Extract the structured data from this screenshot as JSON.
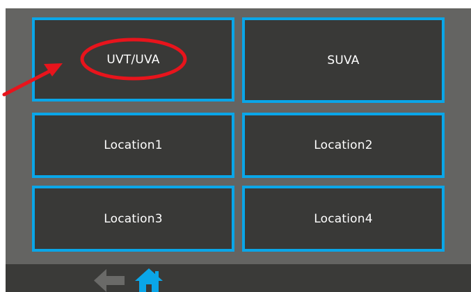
{
  "tiles": [
    {
      "label": "UVT/UVA"
    },
    {
      "label": "SUVA"
    },
    {
      "label": "Location1"
    },
    {
      "label": "Location2"
    },
    {
      "label": "Location3"
    },
    {
      "label": "Location4"
    }
  ],
  "bottom_bar": {
    "icons": [
      "back-arrow-icon",
      "home-icon"
    ]
  },
  "colors": {
    "panel_background": "#646462",
    "tile_background": "#393937",
    "tile_border": "#0aa6e8",
    "home_icon": "#0aa6e8",
    "back_icon": "#6a6a68",
    "annotation": "#e8141c"
  }
}
